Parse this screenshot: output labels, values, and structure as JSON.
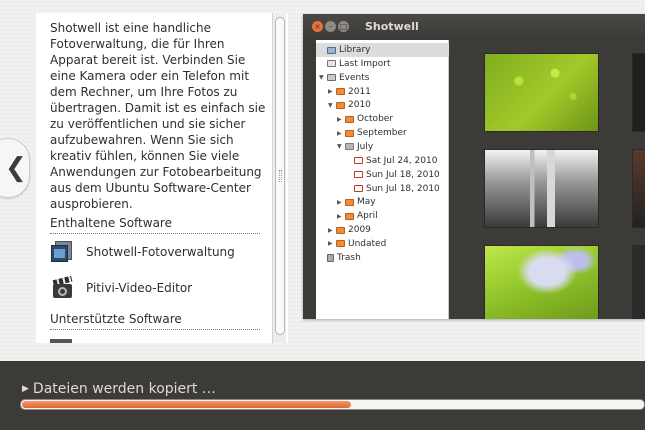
{
  "description": {
    "text": "Shotwell ist eine handliche Fotoverwaltung, die für Ihren Apparat bereit ist. Verbinden Sie eine Kamera oder ein Telefon mit dem Rechner, um Ihre Fotos zu übertragen. Damit ist es einfach sie zu veröffentlichen und sie sicher aufzubewahren. Wenn Sie sich kreativ fühlen, können Sie viele Anwendungen zur Fotobearbeitung aus dem Ubuntu Software-Center ausprobieren."
  },
  "included": {
    "title": "Enthaltene Software",
    "items": [
      {
        "label": "Shotwell-Fotoverwaltung",
        "icon": "shotwell-icon"
      },
      {
        "label": "Pitivi-Video-Editor",
        "icon": "pitivi-icon"
      }
    ]
  },
  "supported": {
    "title": "Unterstützte Software"
  },
  "screenshot": {
    "window_title": "Shotwell",
    "window_buttons": [
      "×",
      "–",
      "□"
    ],
    "sidebar": [
      {
        "label": "Library",
        "icon": "library-icon",
        "indent": 0,
        "arrow": "",
        "selected": true
      },
      {
        "label": "Last Import",
        "icon": "import-icon",
        "indent": 0,
        "arrow": ""
      },
      {
        "label": "Events",
        "icon": "events-icon",
        "indent": 0,
        "arrow": "▼"
      },
      {
        "label": "2011",
        "icon": "folder-icon",
        "indent": 1,
        "arrow": "▶"
      },
      {
        "label": "2010",
        "icon": "folder-icon",
        "indent": 1,
        "arrow": "▼"
      },
      {
        "label": "October",
        "icon": "folder-icon",
        "indent": 2,
        "arrow": "▶"
      },
      {
        "label": "September",
        "icon": "folder-icon",
        "indent": 2,
        "arrow": "▶"
      },
      {
        "label": "July",
        "icon": "folder-open-icon",
        "indent": 2,
        "arrow": "▼"
      },
      {
        "label": "Sat Jul 24, 2010",
        "icon": "day-icon",
        "indent": 3,
        "arrow": ""
      },
      {
        "label": "Sun Jul 18, 2010",
        "icon": "day-icon",
        "indent": 3,
        "arrow": ""
      },
      {
        "label": "Sun Jul 18, 2010",
        "icon": "day-icon",
        "indent": 3,
        "arrow": ""
      },
      {
        "label": "May",
        "icon": "folder-icon",
        "indent": 2,
        "arrow": "▶"
      },
      {
        "label": "April",
        "icon": "folder-icon",
        "indent": 2,
        "arrow": "▶"
      },
      {
        "label": "2009",
        "icon": "folder-icon",
        "indent": 1,
        "arrow": "▶"
      },
      {
        "label": "Undated",
        "icon": "folder-icon",
        "indent": 1,
        "arrow": "▶"
      },
      {
        "label": "Trash",
        "icon": "trash-icon",
        "indent": 0,
        "arrow": ""
      }
    ]
  },
  "progress": {
    "label": "Dateien werden kopiert …",
    "fraction": 0.53,
    "color": "#e5622d"
  },
  "navigation": {
    "back_glyph": "❮"
  }
}
